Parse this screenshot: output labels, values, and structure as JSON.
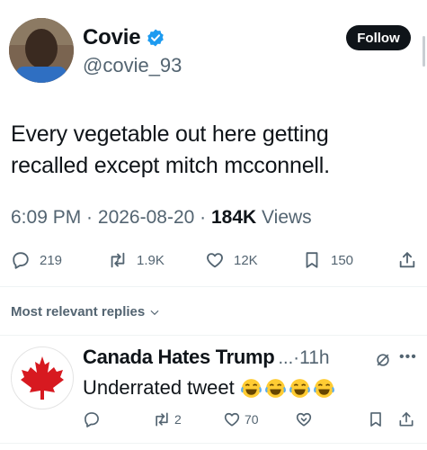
{
  "author": {
    "name": "Covie",
    "handle": "@covie_93",
    "verified": true,
    "verified_color": "#1d9bf0"
  },
  "follow_button": {
    "label": "Follow"
  },
  "tweet": {
    "line1": "Every vegetable out here getting",
    "line2": "recalled except mitch mcconnell.",
    "time": "6:09 PM",
    "sep1": " · ",
    "date": "2026-08-20",
    "sep2": " · ",
    "views_count": "184K",
    "views_label": " Views"
  },
  "actions": {
    "replies": "219",
    "reposts": "1.9K",
    "likes": "12K",
    "bookmarks": "150"
  },
  "replies_sort": {
    "label": "Most relevant replies"
  },
  "reply": {
    "name": "Canada Hates Trump",
    "ellipsis": " ...",
    "separator": " · ",
    "time": "11h",
    "text": "Underrated tweet",
    "emoji": [
      "face-with-tears-of-joy",
      "face-with-tears-of-joy",
      "face-with-tears-of-joy",
      "face-with-tears-of-joy"
    ],
    "reposts": "2",
    "likes": "70"
  },
  "icons": [
    "verified-badge-icon",
    "reply-icon",
    "repost-icon",
    "like-icon",
    "bookmark-icon",
    "share-icon",
    "chevron-down-icon",
    "grok-icon",
    "more-icon",
    "analytics-icon",
    "maple-leaf-icon"
  ],
  "colors": {
    "text_primary": "#0f1419",
    "text_secondary": "#536471",
    "follow_bg": "#0f1419",
    "maple_leaf": "#d71920"
  }
}
